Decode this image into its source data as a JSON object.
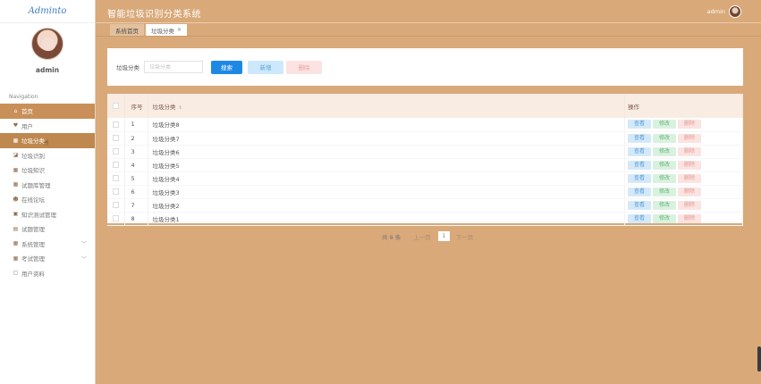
{
  "sidebar": {
    "logo": "Adminto",
    "username": "admin",
    "nav_caption": "Navigation",
    "items": [
      {
        "label": "首页",
        "icon": "home-icon",
        "glyph": "⌂",
        "state": "active",
        "chevron": ""
      },
      {
        "label": "用户",
        "icon": "user-pin-icon",
        "glyph": "♥",
        "state": "",
        "chevron": ""
      },
      {
        "label": "垃圾分类",
        "icon": "grid-icon",
        "glyph": "▦",
        "state": "highlight",
        "chevron": ""
      },
      {
        "label": "垃圾识别",
        "icon": "recognize-icon",
        "glyph": "◪",
        "state": "",
        "chevron": ""
      },
      {
        "label": "垃圾知识",
        "icon": "grid-icon",
        "glyph": "▦",
        "state": "",
        "chevron": ""
      },
      {
        "label": "试题库管理",
        "icon": "grid-icon",
        "glyph": "▦",
        "state": "",
        "chevron": ""
      },
      {
        "label": "在线论坛",
        "icon": "person-icon",
        "glyph": "☻",
        "state": "",
        "chevron": ""
      },
      {
        "label": "知识测试管理",
        "icon": "briefcase-icon",
        "glyph": "▣",
        "state": "",
        "chevron": ""
      },
      {
        "label": "试题管理",
        "icon": "calendar-icon",
        "glyph": "▤",
        "state": "",
        "chevron": ""
      },
      {
        "label": "系统管理",
        "icon": "grid-icon",
        "glyph": "▦",
        "state": "",
        "chevron": "﹀"
      },
      {
        "label": "考试管理",
        "icon": "grid-icon",
        "glyph": "▦",
        "state": "",
        "chevron": "﹀"
      },
      {
        "label": "用户资料",
        "icon": "calendar-icon",
        "glyph": "▢",
        "state": "",
        "chevron": ""
      }
    ]
  },
  "header": {
    "title": "智能垃圾识别分类系统",
    "user": "admin"
  },
  "tabs": [
    {
      "label": "系统首页",
      "active": false,
      "closable": false
    },
    {
      "label": "垃圾分类",
      "active": true,
      "closable": true
    }
  ],
  "tab_close_glyph": "✕",
  "search": {
    "label": "垃圾分类",
    "placeholder": "垃圾分类",
    "value": "",
    "search_button": "搜索",
    "add_button": "新增",
    "delete_button": "删除"
  },
  "table": {
    "headers": {
      "index": "序号",
      "name": "垃圾分类",
      "ops": "操作"
    },
    "sort_glyph": "⇕",
    "rows": [
      {
        "index": "1",
        "name": "垃圾分类8"
      },
      {
        "index": "2",
        "name": "垃圾分类7"
      },
      {
        "index": "3",
        "name": "垃圾分类6"
      },
      {
        "index": "4",
        "name": "垃圾分类5"
      },
      {
        "index": "5",
        "name": "垃圾分类4"
      },
      {
        "index": "6",
        "name": "垃圾分类3"
      },
      {
        "index": "7",
        "name": "垃圾分类2"
      },
      {
        "index": "8",
        "name": "垃圾分类1"
      }
    ],
    "row_actions": {
      "view": "查看",
      "edit": "修改",
      "delete": "删除"
    }
  },
  "pagination": {
    "total": "共 8 条",
    "prev": "上一页",
    "page": "1",
    "next": "下一页"
  },
  "colors": {
    "background": "#d9a979",
    "nav_active": "#c98f58",
    "primary": "#1e88e5"
  }
}
